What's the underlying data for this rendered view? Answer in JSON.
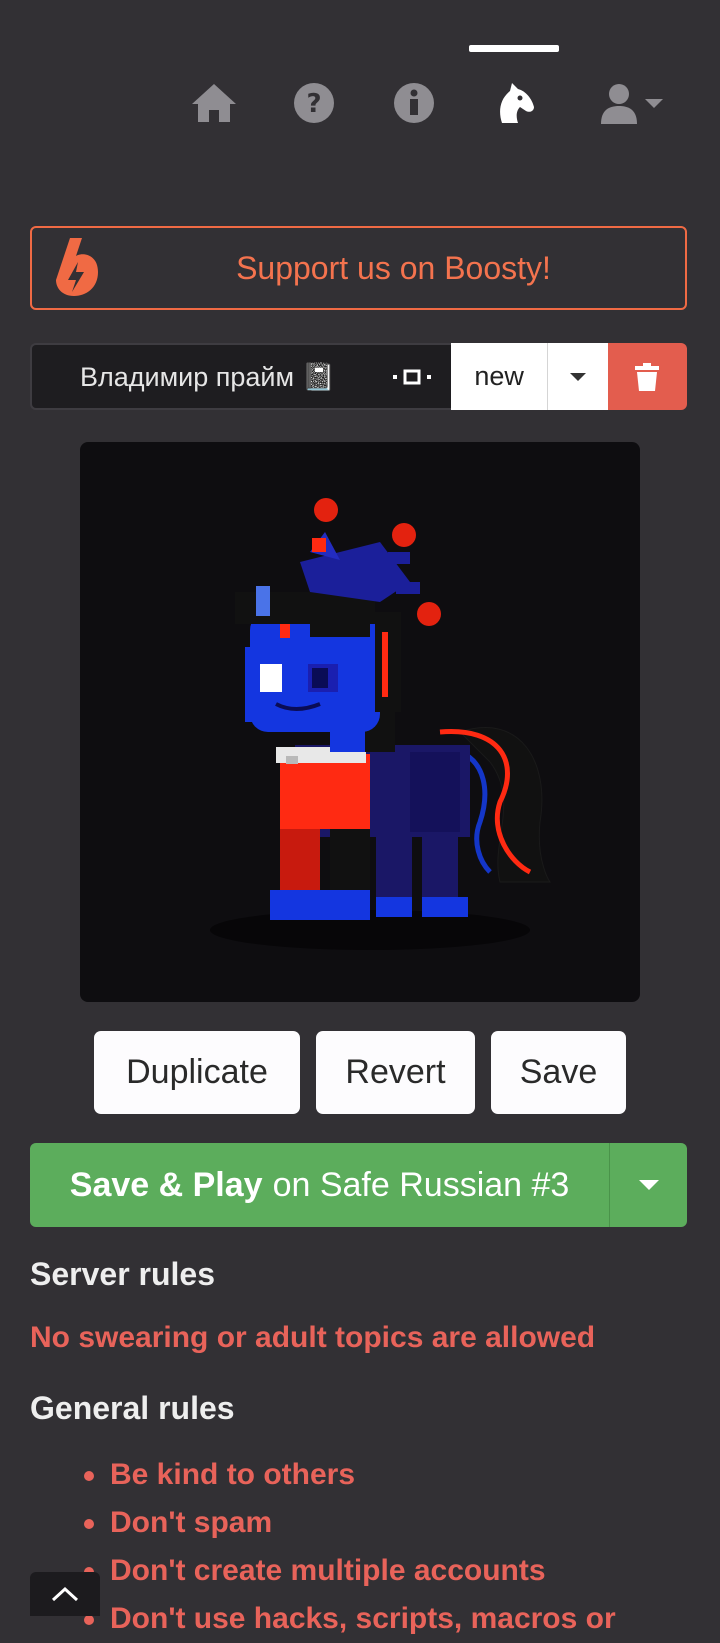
{
  "nav": {
    "items": [
      {
        "icon": "home-icon"
      },
      {
        "icon": "help-icon"
      },
      {
        "icon": "info-icon"
      },
      {
        "icon": "horse-head-icon",
        "active": true
      },
      {
        "icon": "user-icon"
      }
    ]
  },
  "boosty": {
    "text": "Support us on Boosty!",
    "color": "#f06a44"
  },
  "character": {
    "name": "Владимир прайм 📓",
    "tag": "new",
    "delete_color": "#e35d4e"
  },
  "actions": {
    "duplicate": "Duplicate",
    "revert": "Revert",
    "save": "Save"
  },
  "play": {
    "bold": "Save & Play",
    "rest": "on Safe Russian #3",
    "color": "#5cad5c"
  },
  "rules": {
    "server_heading": "Server rules",
    "server_text": "No swearing or adult topics are allowed",
    "general_heading": "General rules",
    "general": [
      "Be kind to others",
      "Don't spam",
      "Don't create multiple accounts",
      "Don't use hacks, scripts, macros or"
    ]
  }
}
